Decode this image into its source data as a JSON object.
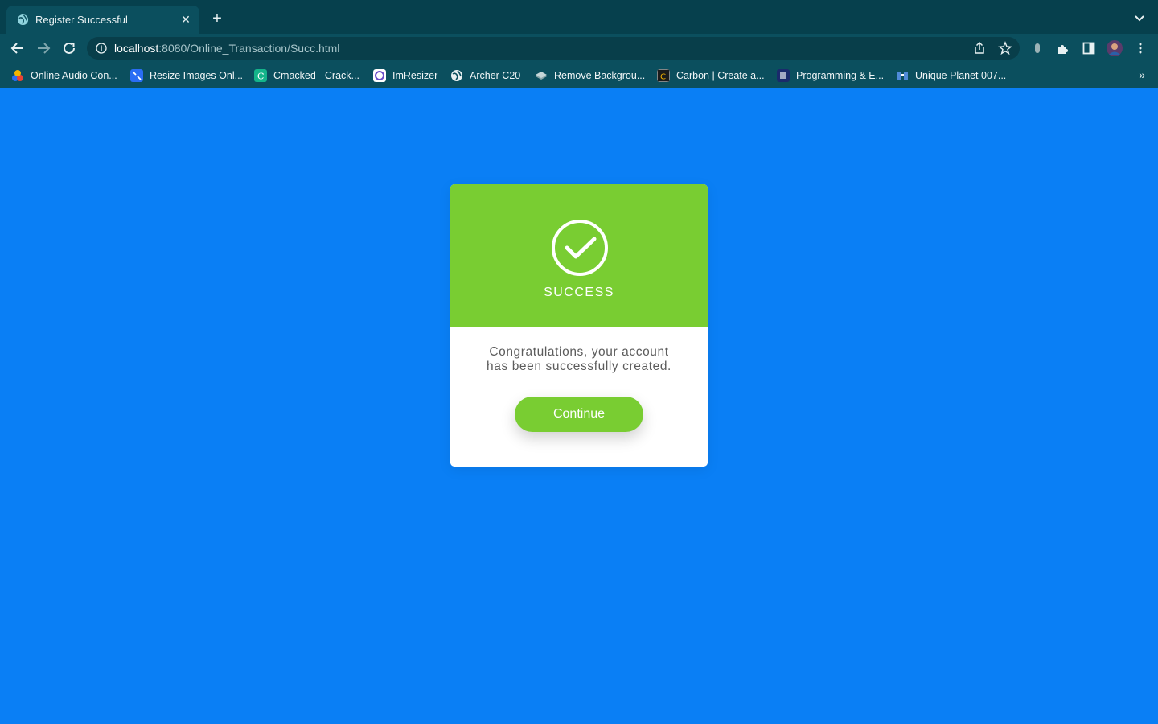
{
  "browser": {
    "tab": {
      "title": "Register Successful",
      "favicon": "globe-icon"
    },
    "address": {
      "host": "localhost",
      "path": ":8080/Online_Transaction/Succ.html"
    },
    "bookmarks": [
      {
        "label": "Online Audio Con...",
        "icon": "audio-converter-icon",
        "color": "#f4b400"
      },
      {
        "label": "Resize Images Onl...",
        "icon": "resize-images-icon",
        "color": "#2a6df4"
      },
      {
        "label": "Cmacked - Crack...",
        "icon": "cmacked-icon",
        "color": "#14b48a"
      },
      {
        "label": "ImResizer",
        "icon": "imresizer-icon",
        "color": "#6a4cc9"
      },
      {
        "label": "Archer C20",
        "icon": "globe-icon",
        "color": "#e8f1f2"
      },
      {
        "label": "Remove Backgrou...",
        "icon": "remove-bg-icon",
        "color": "#8aa7ab"
      },
      {
        "label": "Carbon | Create a...",
        "icon": "carbon-icon",
        "color": "#1b1b1b"
      },
      {
        "label": "Programming & E...",
        "icon": "programming-icon",
        "color": "#1a2a6c"
      },
      {
        "label": "Unique Planet 007...",
        "icon": "unique-planet-icon",
        "color": "#4f8ad8"
      }
    ],
    "more_bookmarks": "»"
  },
  "card": {
    "status": "SUCCESS",
    "message_line1": "Congratulations, your account",
    "message_line2": "has been successfully created.",
    "button_label": "Continue",
    "accent_color": "#79cd32",
    "page_background": "#0a7ff5"
  }
}
